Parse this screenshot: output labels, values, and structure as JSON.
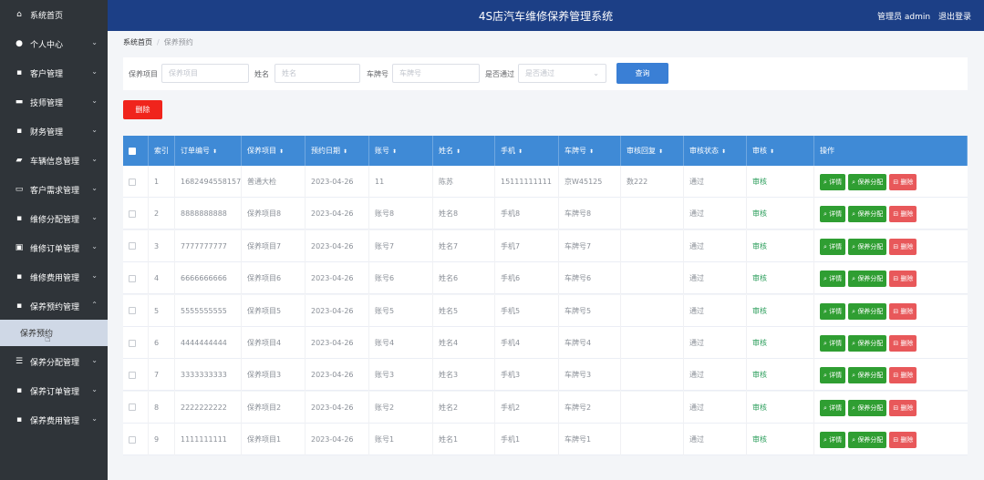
{
  "header": {
    "title": "4S店汽车维修保养管理系统",
    "user_label": "管理员 admin",
    "logout": "退出登录"
  },
  "sidebar": {
    "items": [
      {
        "icon": "home-icon",
        "glyph": "⌂",
        "label": "系统首页",
        "chevron": ""
      },
      {
        "icon": "person-icon",
        "glyph": "●",
        "label": "个人中心",
        "chevron": "⌄"
      },
      {
        "icon": "grid-icon",
        "glyph": "▪",
        "label": "客户管理",
        "chevron": "⌄"
      },
      {
        "icon": "card-icon",
        "glyph": "▬",
        "label": "技师管理",
        "chevron": "⌄"
      },
      {
        "icon": "grid-icon",
        "glyph": "▪",
        "label": "财务管理",
        "chevron": "⌄"
      },
      {
        "icon": "car-icon",
        "glyph": "▰",
        "label": "车辆信息管理",
        "chevron": "⌄"
      },
      {
        "icon": "monitor-icon",
        "glyph": "▭",
        "label": "客户需求管理",
        "chevron": "⌄"
      },
      {
        "icon": "grid-icon",
        "glyph": "▪",
        "label": "维修分配管理",
        "chevron": "⌄"
      },
      {
        "icon": "clipboard-icon",
        "glyph": "▣",
        "label": "维修订单管理",
        "chevron": "⌄"
      },
      {
        "icon": "grid-icon",
        "glyph": "▪",
        "label": "维修费用管理",
        "chevron": "⌄"
      },
      {
        "icon": "grid-icon",
        "glyph": "▪",
        "label": "保养预约管理",
        "chevron": "⌃"
      }
    ],
    "sub_active": "保养预约",
    "items_after": [
      {
        "icon": "menu-icon",
        "glyph": "☰",
        "label": "保养分配管理",
        "chevron": "⌄"
      },
      {
        "icon": "grid-icon",
        "glyph": "▪",
        "label": "保养订单管理",
        "chevron": "⌄"
      },
      {
        "icon": "grid-icon",
        "glyph": "▪",
        "label": "保养费用管理",
        "chevron": "⌄"
      }
    ]
  },
  "breadcrumb": {
    "home": "系统首页",
    "sep": "/",
    "current": "保养预约"
  },
  "search": {
    "fields": [
      {
        "label": "保养项目",
        "placeholder": "保养项目"
      },
      {
        "label": "姓名",
        "placeholder": "姓名"
      },
      {
        "label": "车牌号",
        "placeholder": "车牌号"
      },
      {
        "label": "是否通过",
        "placeholder": "是否通过"
      }
    ],
    "query_button": "查询"
  },
  "delete_button": "删除",
  "table": {
    "columns": [
      "",
      "索引",
      "订单编号",
      "保养项目",
      "预约日期",
      "账号",
      "姓名",
      "手机",
      "车牌号",
      "审核回复",
      "审核状态",
      "审核",
      "操作"
    ],
    "sortable": [
      false,
      false,
      true,
      true,
      true,
      true,
      true,
      true,
      true,
      true,
      true,
      true,
      false
    ],
    "sort_glyph": "⬍",
    "row_actions": {
      "detail": "详情",
      "assign": "保养分配",
      "delete": "删除"
    },
    "rows": [
      {
        "index": "1",
        "order_no": "1682494558157",
        "item": "普通大检",
        "date": "2023-04-26",
        "account": "11",
        "name": "陈苏",
        "phone": "15111111111",
        "plate": "京W45125",
        "reply": "数222",
        "status": "通过",
        "audit": "审核"
      },
      {
        "index": "2",
        "order_no": "8888888888",
        "item": "保养项目8",
        "date": "2023-04-26",
        "account": "账号8",
        "name": "姓名8",
        "phone": "手机8",
        "plate": "车牌号8",
        "reply": "",
        "status": "通过",
        "audit": "审核"
      },
      {
        "index": "3",
        "order_no": "7777777777",
        "item": "保养项目7",
        "date": "2023-04-26",
        "account": "账号7",
        "name": "姓名7",
        "phone": "手机7",
        "plate": "车牌号7",
        "reply": "",
        "status": "通过",
        "audit": "审核"
      },
      {
        "index": "4",
        "order_no": "6666666666",
        "item": "保养项目6",
        "date": "2023-04-26",
        "account": "账号6",
        "name": "姓名6",
        "phone": "手机6",
        "plate": "车牌号6",
        "reply": "",
        "status": "通过",
        "audit": "审核"
      },
      {
        "index": "5",
        "order_no": "5555555555",
        "item": "保养项目5",
        "date": "2023-04-26",
        "account": "账号5",
        "name": "姓名5",
        "phone": "手机5",
        "plate": "车牌号5",
        "reply": "",
        "status": "通过",
        "audit": "审核"
      },
      {
        "index": "6",
        "order_no": "4444444444",
        "item": "保养项目4",
        "date": "2023-04-26",
        "account": "账号4",
        "name": "姓名4",
        "phone": "手机4",
        "plate": "车牌号4",
        "reply": "",
        "status": "通过",
        "audit": "审核"
      },
      {
        "index": "7",
        "order_no": "3333333333",
        "item": "保养项目3",
        "date": "2023-04-26",
        "account": "账号3",
        "name": "姓名3",
        "phone": "手机3",
        "plate": "车牌号3",
        "reply": "",
        "status": "通过",
        "audit": "审核"
      },
      {
        "index": "8",
        "order_no": "2222222222",
        "item": "保养项目2",
        "date": "2023-04-26",
        "account": "账号2",
        "name": "姓名2",
        "phone": "手机2",
        "plate": "车牌号2",
        "reply": "",
        "status": "通过",
        "audit": "审核"
      },
      {
        "index": "9",
        "order_no": "1111111111",
        "item": "保养项目1",
        "date": "2023-04-26",
        "account": "账号1",
        "name": "姓名1",
        "phone": "手机1",
        "plate": "车牌号1",
        "reply": "",
        "status": "通过",
        "audit": "审核"
      }
    ]
  }
}
